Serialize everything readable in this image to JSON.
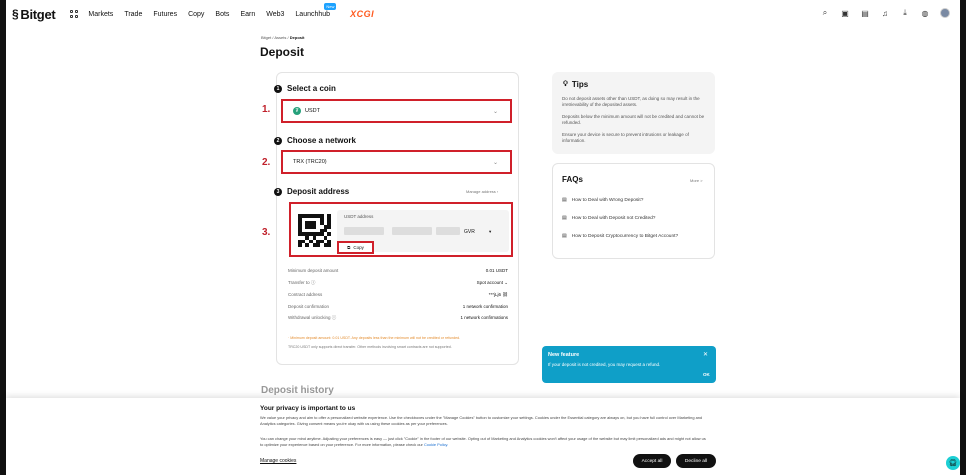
{
  "nav": {
    "brand": "Bitget",
    "items": [
      "Markets",
      "Trade",
      "Futures",
      "Copy",
      "Bots",
      "Earn",
      "Web3",
      "Launchhub"
    ],
    "new_badge": "New",
    "promo": "XCGI"
  },
  "breadcrumb": {
    "a": "Bitget",
    "sep1": "/",
    "b": "Assets",
    "sep2": "/",
    "c": "Deposit"
  },
  "title": "Deposit",
  "steps": {
    "select_coin": {
      "num": "1",
      "label": "Select a coin",
      "value": "USDT",
      "marker": "1."
    },
    "choose_network": {
      "num": "2",
      "label": "Choose a network",
      "value": "TRX (TRC20)",
      "marker": "2."
    },
    "deposit_address": {
      "num": "3",
      "label": "Deposit address",
      "manage": "Manage address",
      "marker": "3."
    }
  },
  "address": {
    "label": "USDT address",
    "suffix": "GVR",
    "copy": "Copy"
  },
  "details": [
    {
      "k": "Minimum deposit amount",
      "v": "0.01 USDT"
    },
    {
      "k": "Transfer to",
      "v": "Spot account"
    },
    {
      "k": "Contract address",
      "v": "***jLj6"
    },
    {
      "k": "Deposit confirmation",
      "v": "1 network confirmation"
    },
    {
      "k": "Withdrawal unlocking",
      "v": "1 network confirmations"
    }
  ],
  "warning": "· Minimum deposit amount: 0.01 USDT. Any deposits less than the minimum will not be credited or refunded.",
  "note": "TRC20 USDT only supports direct transfer. Other methods involving smart contracts are not supported.",
  "history_title": "Deposit history",
  "tips": {
    "title": "Tips",
    "items": [
      "Do not deposit assets other than USDT, as doing so may result in the irretrievability of the deposited assets.",
      "Deposits below the minimum amount will not be credited and cannot be refunded.",
      "Ensure your device is secure to prevent intrusions or leakage of information."
    ]
  },
  "faqs": {
    "title": "FAQs",
    "more": "More >",
    "items": [
      "How to Deal with Wrong Deposit?",
      "How to Deal with Deposit not Credited?",
      "How to Deposit Cryptocurrency to Bitget Account?"
    ]
  },
  "popup": {
    "title": "New feature",
    "text": "If your deposit is not credited, you may request a refund.",
    "ok": "OK"
  },
  "cookie": {
    "title": "Your privacy is important to us",
    "p1": "We value your privacy and aim to offer a personalized website experience. Use the checkboxes under the \"Manage Cookies\" button to customize your settings. Cookies under the Essential category are always on, but you have full control over Marketing and Analytics categories. Giving consent means you're okay with us using these cookies as per your preferences.",
    "p2": "You can change your mind anytime. Adjusting your preferences is easy — just click \"Cookie\" in the footer of our website. Opting out of Marketing and Analytics cookies won't affect your usage of the website but may limit personalized ads and might not allow us to optimize your experience based on your preference. For more information, please check our",
    "policy": "Cookie Policy.",
    "manage": "Manage cookies",
    "accept": "Accept all",
    "decline": "Decline all"
  }
}
